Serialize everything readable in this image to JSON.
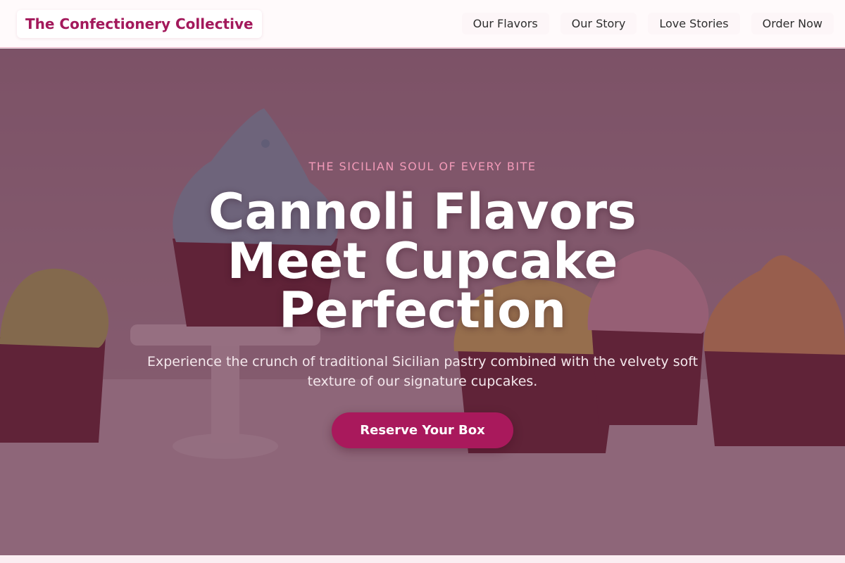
{
  "header": {
    "brand": "The Confectionery Collective",
    "nav": [
      {
        "label": "Our Flavors"
      },
      {
        "label": "Our Story"
      },
      {
        "label": "Love Stories"
      },
      {
        "label": "Order Now"
      }
    ]
  },
  "hero": {
    "eyebrow": "THE SICILIAN SOUL OF EVERY BITE",
    "headline": "Cannoli Flavors Meet Cupcake Perfection",
    "subhead": "Experience the crunch of traditional Sicilian pastry combined with the velvety soft texture of our signature cupcakes.",
    "cta_label": "Reserve Your Box"
  },
  "colors": {
    "brand": "#a3195b",
    "accent_pink": "#f29ab8",
    "cta": "#a9195c",
    "overlay": "#5a1e3c"
  }
}
